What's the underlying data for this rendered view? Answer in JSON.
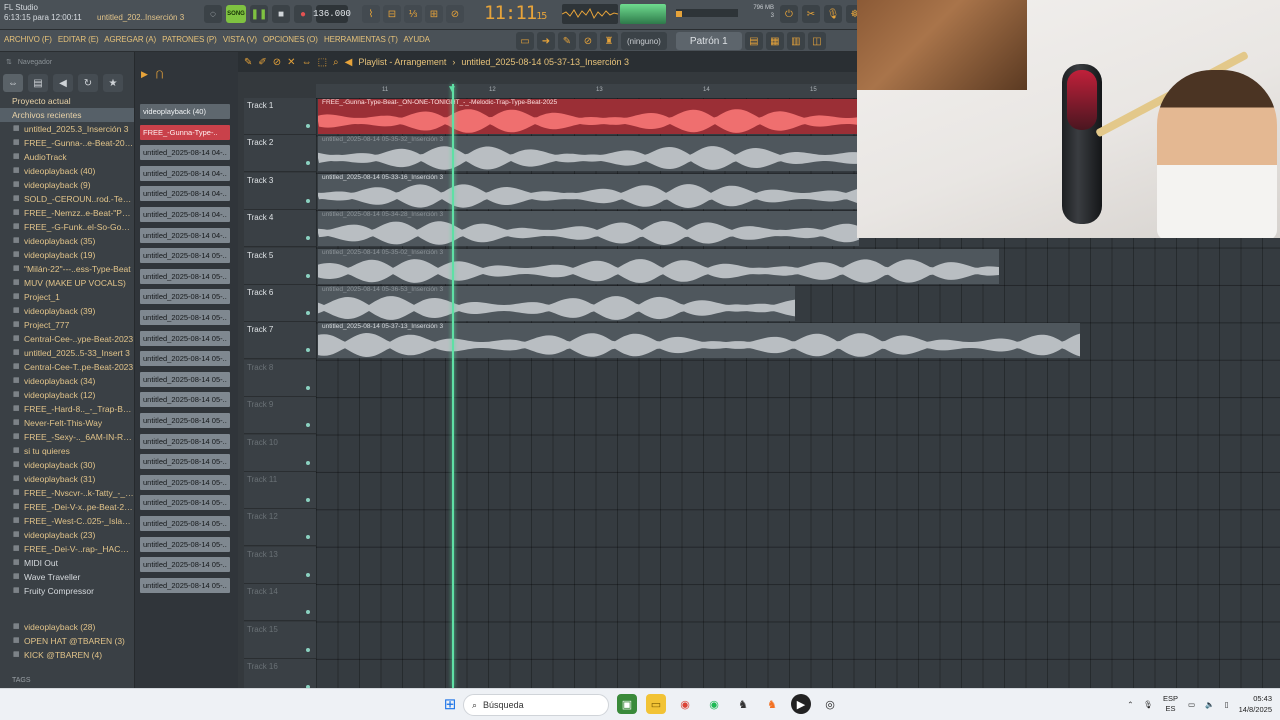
{
  "app": {
    "title": "FL Studio",
    "timestamp": "6:13:15 para 12:00:11",
    "song_name": "untitled_202..Inserción 3",
    "tempo": "136.000",
    "time_main": "11:11",
    "time_sub": "15",
    "memory": "796 MB",
    "cpu": "3",
    "song_mode": "SONG",
    "pattern": "Patrón 1",
    "pattern_none": "(ninguno)"
  },
  "menu": [
    "ARCHIVO (F)",
    "EDITAR (E)",
    "AGREGAR (A)",
    "PATRONES (P)",
    "VISTA (V)",
    "OPCIONES (O)",
    "HERRAMIENTAS (T)",
    "AYUDA"
  ],
  "browser": {
    "header": "Navegador",
    "sections": [
      "Proyecto actual",
      "Archivos recientes"
    ],
    "items": [
      "untitled_2025.3_Inserción 3",
      "FREE_-Gunna-..e-Beat-2025",
      "AudioTrack",
      "videoplayback (40)",
      "videoplayback (9)",
      "SOLD_-CEROUN..rod.-Tecusi",
      "FREE_-Nemzz..e-Beat-\"Pain\"",
      "FREE_-G-Funk..el-So-Good_",
      "videoplayback (35)",
      "videoplayback (19)",
      "\"Milán-22\"---..ess-Type-Beat",
      "MUV (MAKE UP VOCALS)",
      "Project_1",
      "videoplayback (39)",
      "Project_777",
      "Central-Cee-..ype-Beat-2023",
      "untitled_2025..5-33_Insert 3",
      "Central-Cee-T..pe-Beat-2023",
      "videoplayback (34)",
      "videoplayback (12)",
      "FREE_-Hard-8.._-_Trap-Beat",
      "Never-Felt-This-Way",
      "FREE_-Sexy-.._6AM-IN-RIO_",
      "si tu quieres",
      "videoplayback (30)",
      "videoplayback (31)",
      "FREE_-Nvscvr-..k-Tatty_-_1_",
      "FREE_-Dei-V-x..pe-Beat-2025",
      "FREE_-West-C..025-_Island_",
      "videoplayback (23)",
      "FREE_-Dei-V-..rap-_HACKIA_",
      "MIDI Out",
      "Wave Traveller",
      "Fruity Compressor"
    ],
    "items_bottom": [
      "videoplayback (28)",
      "OPEN HAT @TBAREN  (3)",
      "KICK @TBAREN (4)"
    ],
    "tags": "TAGS"
  },
  "picker": {
    "clips": [
      "videoplayback (40)",
      "FREE_-Gunna-Type-..",
      "untitled_2025-08-14 04-..",
      "untitled_2025-08-14 04-..",
      "untitled_2025-08-14 04-..",
      "untitled_2025-08-14 04-..",
      "untitled_2025-08-14 04-..",
      "untitled_2025-08-14 05-..",
      "untitled_2025-08-14 05-..",
      "untitled_2025-08-14 05-..",
      "untitled_2025-08-14 05-..",
      "untitled_2025-08-14 05-..",
      "untitled_2025-08-14 05-..",
      "untitled_2025-08-14 05-..",
      "untitled_2025-08-14 05-..",
      "untitled_2025-08-14 05-..",
      "untitled_2025-08-14 05-..",
      "untitled_2025-08-14 05-..",
      "untitled_2025-08-14 05-..",
      "untitled_2025-08-14 05-..",
      "untitled_2025-08-14 05-..",
      "untitled_2025-08-14 05-..",
      "untitled_2025-08-14 05-..",
      "untitled_2025-08-14 05-.."
    ]
  },
  "playlist": {
    "title": "Playlist - Arrangement",
    "path": "untitled_2025-08-14 05-37-13_Inserción 3",
    "ruler": [
      "11",
      "12",
      "13",
      "14",
      "15"
    ],
    "tracks": [
      "Track 1",
      "Track 2",
      "Track 3",
      "Track 4",
      "Track 5",
      "Track 6",
      "Track 7",
      "Track 8",
      "Track 9",
      "Track 10",
      "Track 11",
      "Track 12",
      "Track 13",
      "Track 14",
      "Track 15",
      "Track 16"
    ],
    "clips": [
      "FREE_-Gunna-Type-Beat-_ON-ONE-TONIGHT_-_-Melodic-Trap-Type-Beat-2025",
      "untitled_2025-08-14 05-35-32_Inserción 3",
      "untitled_2025-08-14 05-33-16_Inserción 3",
      "untitled_2025-08-14 05-34-28_Inserción 3",
      "untitled_2025-08-14 05-35-02_Inserción 3",
      "untitled_2025-08-14 05-36-53_Inserción 3",
      "untitled_2025-08-14 05-37-13_Inserción 3"
    ]
  },
  "taskbar": {
    "search_placeholder": "Búsqueda",
    "lang_top": "ESP",
    "lang_bottom": "ES",
    "time": "05:43",
    "date": "14/8/2025"
  },
  "colors": {
    "accent_green": "#5fe0a5",
    "clip_red": "#9b2f36",
    "menu_text": "#e6c27a"
  }
}
